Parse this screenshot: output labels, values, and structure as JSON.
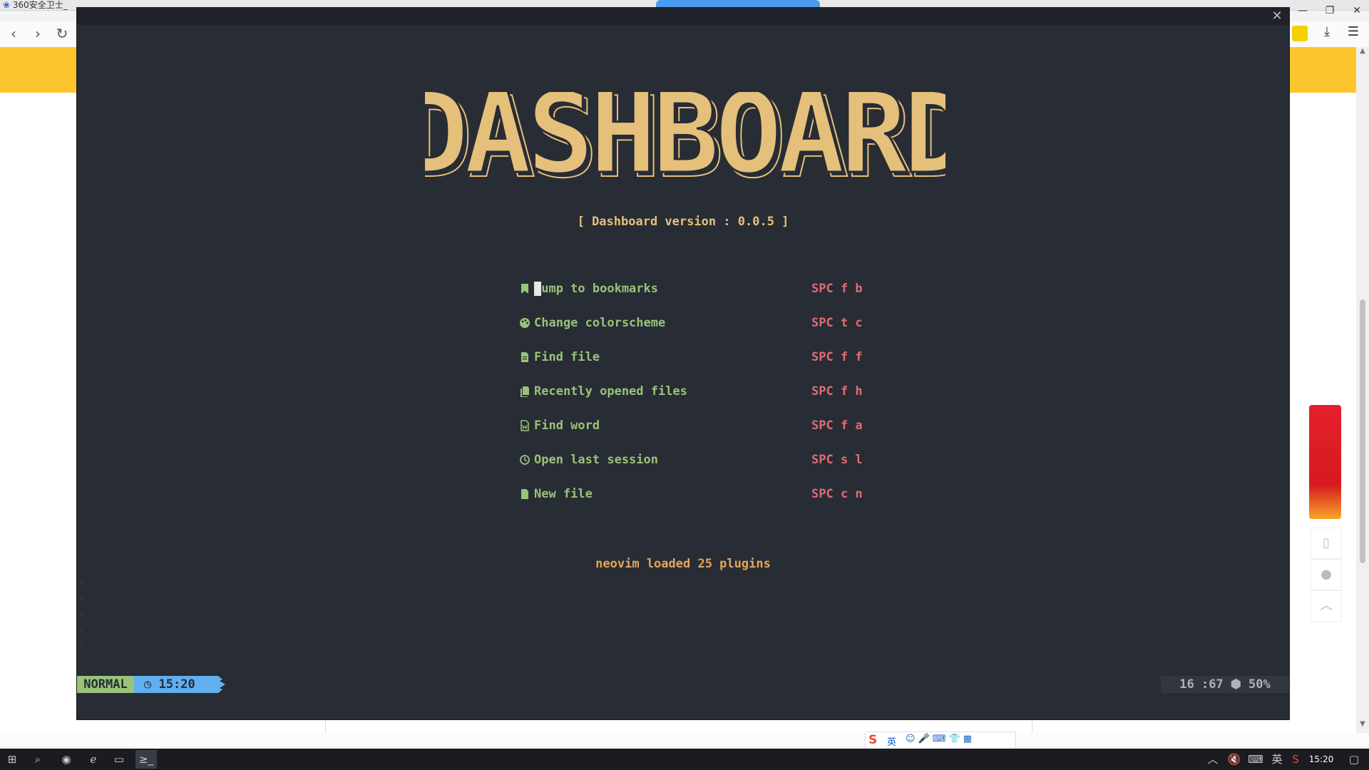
{
  "browser": {
    "tabs": [
      "360安全卫士_"
    ],
    "window_controls": {
      "minimize": "—",
      "restore": "❐",
      "close": "✕"
    },
    "nav": {
      "back": "‹",
      "forward": "›",
      "reload": "↻"
    }
  },
  "terminal": {
    "close_glyph": "✕",
    "logo_text": "DASHBOARD",
    "version_text": "[ Dashboard version : 0.0.5 ]",
    "menu": [
      {
        "icon": "bookmark-icon",
        "label": "Jump to bookmarks",
        "shortcut": "SPC f b"
      },
      {
        "icon": "palette-icon",
        "label": "Change colorscheme",
        "shortcut": "SPC t c"
      },
      {
        "icon": "file-icon",
        "label": "Find file",
        "shortcut": "SPC f f"
      },
      {
        "icon": "files-icon",
        "label": "Recently opened files",
        "shortcut": "SPC f h"
      },
      {
        "icon": "word-file-icon",
        "label": "Find word",
        "shortcut": "SPC f a"
      },
      {
        "icon": "history-icon",
        "label": "Open last session",
        "shortcut": "SPC s l"
      },
      {
        "icon": "new-file-icon",
        "label": "New file",
        "shortcut": "SPC c n"
      }
    ],
    "footer_text": "neovim loaded 25 plugins",
    "statusline": {
      "mode": "NORMAL",
      "time": "15:20",
      "position": "16 :67",
      "percent": "50%"
    }
  },
  "taskbar": {
    "time": "15:20",
    "ime_label": "英"
  },
  "colors": {
    "terminal_bg": "#282c34",
    "logo": "#e5c07b",
    "menu_label": "#98c379",
    "shortcut": "#e06c75",
    "mode_bg": "#98c379",
    "clock_bg": "#61afef",
    "banner": "#fdc52d"
  }
}
